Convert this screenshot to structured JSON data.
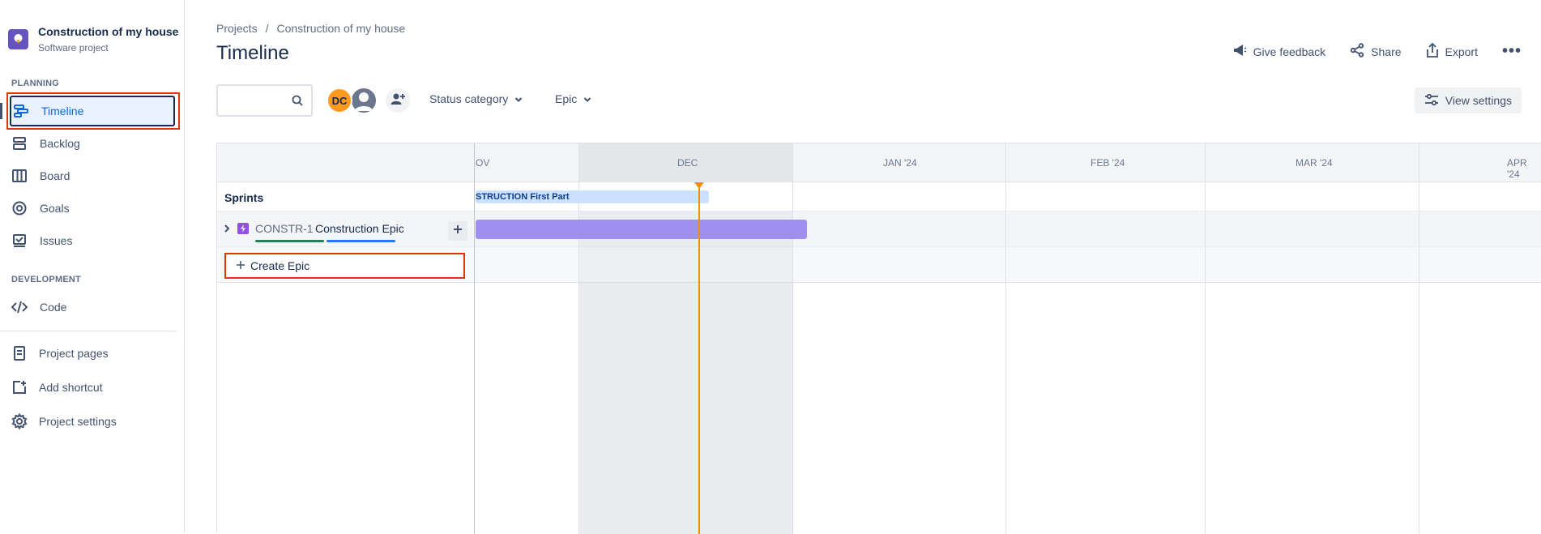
{
  "project": {
    "name": "Construction of my house",
    "type": "Software project"
  },
  "sidebar": {
    "sections": [
      {
        "title": "PLANNING"
      },
      {
        "title": "DEVELOPMENT"
      }
    ],
    "planning_items": [
      {
        "label": "Timeline",
        "icon": "timeline-icon",
        "active": true
      },
      {
        "label": "Backlog",
        "icon": "backlog-icon"
      },
      {
        "label": "Board",
        "icon": "board-icon"
      },
      {
        "label": "Goals",
        "icon": "goals-icon"
      },
      {
        "label": "Issues",
        "icon": "issues-icon"
      }
    ],
    "development_items": [
      {
        "label": "Code",
        "icon": "code-icon"
      }
    ],
    "bottom_items": [
      {
        "label": "Project pages",
        "icon": "pages-icon"
      },
      {
        "label": "Add shortcut",
        "icon": "add-shortcut-icon"
      },
      {
        "label": "Project settings",
        "icon": "gear-icon"
      }
    ]
  },
  "header": {
    "breadcrumb": [
      "Projects",
      "/",
      "Construction of my house"
    ],
    "title": "Timeline",
    "actions": {
      "feedback": "Give feedback",
      "share": "Share",
      "export": "Export",
      "more": "•••"
    }
  },
  "toolbar": {
    "search_placeholder": "",
    "avatar_initials": "DC",
    "filters": {
      "status": "Status category",
      "epic": "Epic"
    },
    "view_settings": "View settings"
  },
  "timeline": {
    "months": [
      "OV",
      "DEC",
      "JAN '24",
      "FEB '24",
      "MAR '24",
      "APR '24"
    ],
    "sprints_label": "Sprints",
    "sprint_bar_label": "STRUCTION First Part",
    "epic": {
      "key": "CONSTR-1",
      "name": "Construction Epic"
    },
    "create_epic": "Create Epic"
  },
  "colors": {
    "accent": "#0c66e4",
    "epic_bar": "#9f8fef",
    "sprint_bar": "#cce0ff",
    "today": "#f18d13",
    "highlight_outline": "#de350b"
  }
}
